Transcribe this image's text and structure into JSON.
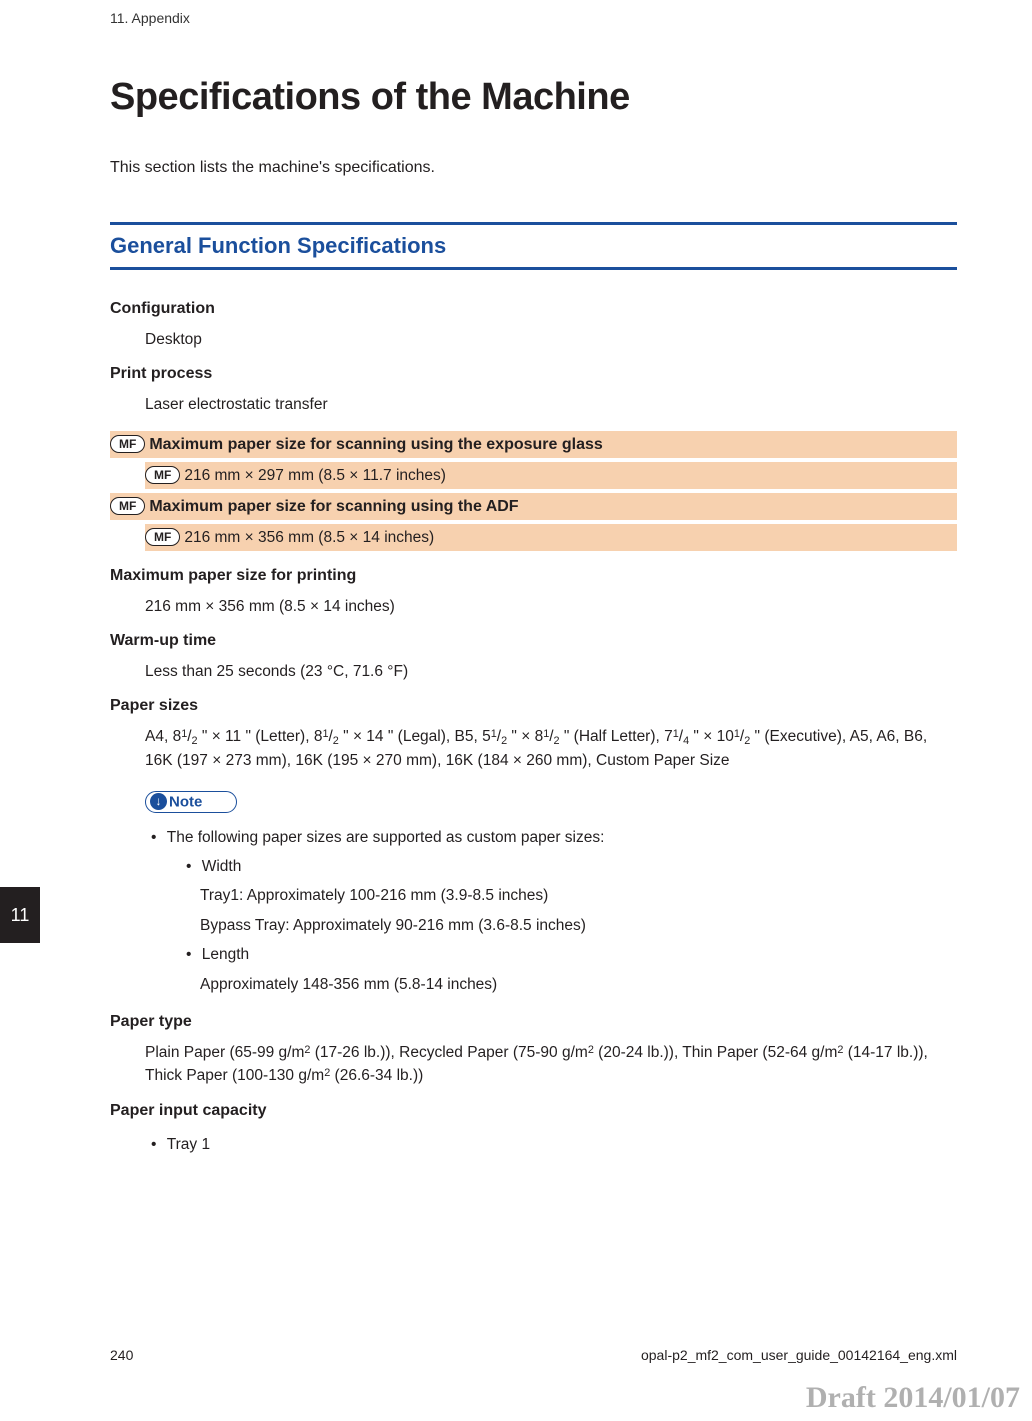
{
  "header": {
    "running": "11. Appendix"
  },
  "title": "Specifications of the Machine",
  "intro": "This section lists the machine's specifications.",
  "section_heading": "General Function Specifications",
  "badges": {
    "mf": "MF",
    "note_label": "Note",
    "note_glyph": "↓"
  },
  "side_tab": "11",
  "specs": {
    "configuration": {
      "term": "Configuration",
      "value": "Desktop"
    },
    "print_process": {
      "term": "Print process",
      "value": "Laser electrostatic transfer"
    },
    "max_scan_glass": {
      "term": "Maximum paper size for scanning using the exposure glass",
      "value": "216 mm × 297 mm (8.5 × 11.7 inches)"
    },
    "max_scan_adf": {
      "term": "Maximum paper size for scanning using the ADF",
      "value": "216 mm × 356 mm (8.5 × 14 inches)"
    },
    "max_print": {
      "term": "Maximum paper size for printing",
      "value": "216 mm × 356 mm (8.5 × 14 inches)"
    },
    "warmup": {
      "term": "Warm-up time",
      "value": "Less than 25 seconds (23 °C, 71.6 °F)"
    },
    "paper_sizes": {
      "term": "Paper sizes",
      "text_parts": {
        "p1": "A4, 8",
        "p2": " \" × 11 \" (Letter), 8",
        "p3": " \" × 14 \" (Legal), B5, 5",
        "p4": " \" × 8",
        "p5": " \" (Half Letter), 7",
        "p6": " \" × 10",
        "p7": " \" (Executive), A5, A6, B6, 16K (197 × 273 mm), 16K (195 × 270 mm), 16K (184 × 260 mm), Custom Paper Size"
      },
      "fracs": {
        "half_sup": "1",
        "half_sub": "2",
        "quarter_sup": "1",
        "quarter_sub": "4"
      }
    },
    "note": {
      "line": "The following paper sizes are supported as custom paper sizes:",
      "width_label": "Width",
      "width_tray1": "Tray1: Approximately 100-216 mm (3.9-8.5 inches)",
      "width_bypass": "Bypass Tray: Approximately 90-216 mm (3.6-8.5 inches)",
      "length_label": "Length",
      "length_val": "Approximately 148-356 mm (5.8-14 inches)"
    },
    "paper_type": {
      "term": "Paper type",
      "parts": {
        "a": "Plain Paper (65-99 g/m",
        "b": " (17-26 lb.)), Recycled Paper (75-90 g/m",
        "c": " (20-24 lb.)), Thin Paper (52-64 g/m",
        "d": " (14-17 lb.)), Thick Paper (100-130 g/m",
        "e": " (26.6-34 lb.))"
      },
      "sq": "2"
    },
    "paper_input": {
      "term": "Paper input capacity",
      "tray1": "Tray 1"
    }
  },
  "footer": {
    "page": "240",
    "file": "opal-p2_mf2_com_user_guide_00142164_eng.xml"
  },
  "draft": "Draft 2014/01/07"
}
